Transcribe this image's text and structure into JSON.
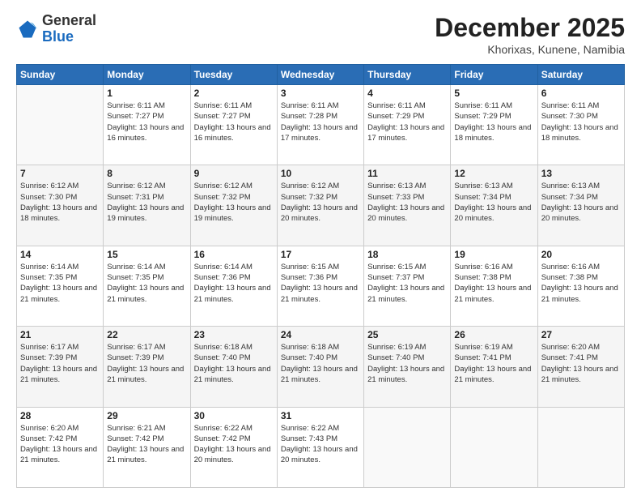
{
  "logo": {
    "general": "General",
    "blue": "Blue"
  },
  "header": {
    "month": "December 2025",
    "location": "Khorixas, Kunene, Namibia"
  },
  "weekdays": [
    "Sunday",
    "Monday",
    "Tuesday",
    "Wednesday",
    "Thursday",
    "Friday",
    "Saturday"
  ],
  "rows": [
    [
      {
        "day": "",
        "empty": true
      },
      {
        "day": "1",
        "sunrise": "6:11 AM",
        "sunset": "7:27 PM",
        "daylight": "13 hours and 16 minutes."
      },
      {
        "day": "2",
        "sunrise": "6:11 AM",
        "sunset": "7:27 PM",
        "daylight": "13 hours and 16 minutes."
      },
      {
        "day": "3",
        "sunrise": "6:11 AM",
        "sunset": "7:28 PM",
        "daylight": "13 hours and 17 minutes."
      },
      {
        "day": "4",
        "sunrise": "6:11 AM",
        "sunset": "7:29 PM",
        "daylight": "13 hours and 17 minutes."
      },
      {
        "day": "5",
        "sunrise": "6:11 AM",
        "sunset": "7:29 PM",
        "daylight": "13 hours and 18 minutes."
      },
      {
        "day": "6",
        "sunrise": "6:11 AM",
        "sunset": "7:30 PM",
        "daylight": "13 hours and 18 minutes."
      }
    ],
    [
      {
        "day": "7",
        "sunrise": "6:12 AM",
        "sunset": "7:30 PM",
        "daylight": "13 hours and 18 minutes."
      },
      {
        "day": "8",
        "sunrise": "6:12 AM",
        "sunset": "7:31 PM",
        "daylight": "13 hours and 19 minutes."
      },
      {
        "day": "9",
        "sunrise": "6:12 AM",
        "sunset": "7:32 PM",
        "daylight": "13 hours and 19 minutes."
      },
      {
        "day": "10",
        "sunrise": "6:12 AM",
        "sunset": "7:32 PM",
        "daylight": "13 hours and 20 minutes."
      },
      {
        "day": "11",
        "sunrise": "6:13 AM",
        "sunset": "7:33 PM",
        "daylight": "13 hours and 20 minutes."
      },
      {
        "day": "12",
        "sunrise": "6:13 AM",
        "sunset": "7:34 PM",
        "daylight": "13 hours and 20 minutes."
      },
      {
        "day": "13",
        "sunrise": "6:13 AM",
        "sunset": "7:34 PM",
        "daylight": "13 hours and 20 minutes."
      }
    ],
    [
      {
        "day": "14",
        "sunrise": "6:14 AM",
        "sunset": "7:35 PM",
        "daylight": "13 hours and 21 minutes."
      },
      {
        "day": "15",
        "sunrise": "6:14 AM",
        "sunset": "7:35 PM",
        "daylight": "13 hours and 21 minutes."
      },
      {
        "day": "16",
        "sunrise": "6:14 AM",
        "sunset": "7:36 PM",
        "daylight": "13 hours and 21 minutes."
      },
      {
        "day": "17",
        "sunrise": "6:15 AM",
        "sunset": "7:36 PM",
        "daylight": "13 hours and 21 minutes."
      },
      {
        "day": "18",
        "sunrise": "6:15 AM",
        "sunset": "7:37 PM",
        "daylight": "13 hours and 21 minutes."
      },
      {
        "day": "19",
        "sunrise": "6:16 AM",
        "sunset": "7:38 PM",
        "daylight": "13 hours and 21 minutes."
      },
      {
        "day": "20",
        "sunrise": "6:16 AM",
        "sunset": "7:38 PM",
        "daylight": "13 hours and 21 minutes."
      }
    ],
    [
      {
        "day": "21",
        "sunrise": "6:17 AM",
        "sunset": "7:39 PM",
        "daylight": "13 hours and 21 minutes."
      },
      {
        "day": "22",
        "sunrise": "6:17 AM",
        "sunset": "7:39 PM",
        "daylight": "13 hours and 21 minutes."
      },
      {
        "day": "23",
        "sunrise": "6:18 AM",
        "sunset": "7:40 PM",
        "daylight": "13 hours and 21 minutes."
      },
      {
        "day": "24",
        "sunrise": "6:18 AM",
        "sunset": "7:40 PM",
        "daylight": "13 hours and 21 minutes."
      },
      {
        "day": "25",
        "sunrise": "6:19 AM",
        "sunset": "7:40 PM",
        "daylight": "13 hours and 21 minutes."
      },
      {
        "day": "26",
        "sunrise": "6:19 AM",
        "sunset": "7:41 PM",
        "daylight": "13 hours and 21 minutes."
      },
      {
        "day": "27",
        "sunrise": "6:20 AM",
        "sunset": "7:41 PM",
        "daylight": "13 hours and 21 minutes."
      }
    ],
    [
      {
        "day": "28",
        "sunrise": "6:20 AM",
        "sunset": "7:42 PM",
        "daylight": "13 hours and 21 minutes."
      },
      {
        "day": "29",
        "sunrise": "6:21 AM",
        "sunset": "7:42 PM",
        "daylight": "13 hours and 21 minutes."
      },
      {
        "day": "30",
        "sunrise": "6:22 AM",
        "sunset": "7:42 PM",
        "daylight": "13 hours and 20 minutes."
      },
      {
        "day": "31",
        "sunrise": "6:22 AM",
        "sunset": "7:43 PM",
        "daylight": "13 hours and 20 minutes."
      },
      {
        "day": "",
        "empty": true
      },
      {
        "day": "",
        "empty": true
      },
      {
        "day": "",
        "empty": true
      }
    ]
  ]
}
